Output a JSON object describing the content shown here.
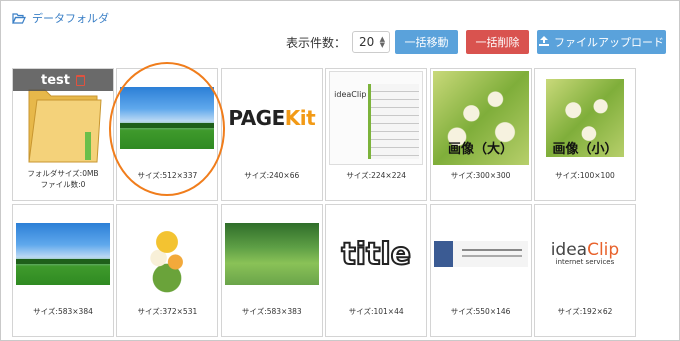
{
  "breadcrumb": {
    "icon": "folder-open-icon",
    "label": "データフォルダ"
  },
  "toolbar": {
    "per_page_label": "表示件数：",
    "per_page_value": "20",
    "move_label": "一括移動",
    "delete_label": "一括削除",
    "upload_label": "ファイルアップロード"
  },
  "colors": {
    "accent": "#5aa2db",
    "danger": "#d9534f",
    "highlight": "#f07d1c"
  },
  "folder": {
    "name": "test",
    "size_text": "フォルダサイズ:0MB",
    "count_text": "ファイル数:0"
  },
  "files": [
    {
      "size": "サイズ:512×337"
    },
    {
      "size": "サイズ:240×66",
      "logo_text_a": "PAGE",
      "logo_text_b": "Kit"
    },
    {
      "size": "サイズ:224×224",
      "logo_text": "ideaClip"
    },
    {
      "size": "サイズ:300×300",
      "overlay": "画像（大）"
    },
    {
      "size": "サイズ:100×100",
      "overlay": "画像（小）"
    },
    {
      "size": "サイズ:583×384"
    },
    {
      "size": "サイズ:372×531"
    },
    {
      "size": "サイズ:583×383"
    },
    {
      "size": "サイズ:101×44",
      "logo_text": "title"
    },
    {
      "size": "サイズ:550×146"
    },
    {
      "size": "サイズ:192×62",
      "logo_text_a": "idea",
      "logo_text_b": "Clip",
      "logo_sub": "internet services"
    }
  ]
}
